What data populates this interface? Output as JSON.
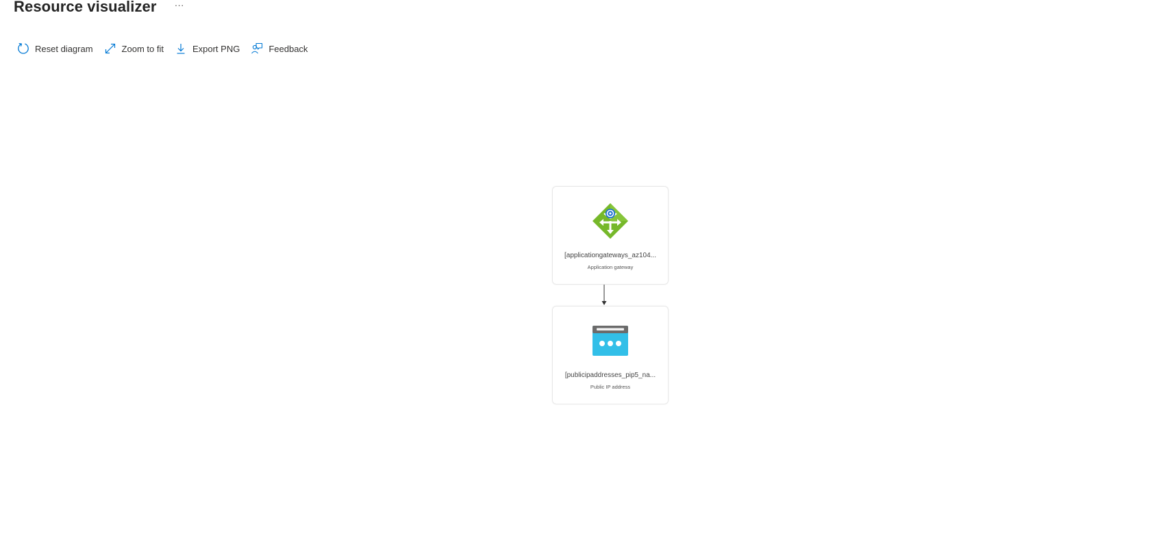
{
  "header": {
    "title": "Resource visualizer",
    "more_label": "···"
  },
  "toolbar": {
    "reset_label": "Reset diagram",
    "zoom_label": "Zoom to fit",
    "export_label": "Export PNG",
    "feedback_label": "Feedback"
  },
  "diagram": {
    "nodes": [
      {
        "name": "[applicationgateways_az104...",
        "type": "Application gateway",
        "icon": "application-gateway-icon"
      },
      {
        "name": "[publicipaddresses_pip5_na...",
        "type": "Public IP address",
        "icon": "public-ip-address-icon"
      }
    ],
    "edges": [
      {
        "from": 0,
        "to": 1
      }
    ]
  },
  "colors": {
    "accent": "#0078d4",
    "gateway_green": "#76b82a",
    "ip_blue": "#32bfe8",
    "ip_header": "#6b6b6b"
  }
}
